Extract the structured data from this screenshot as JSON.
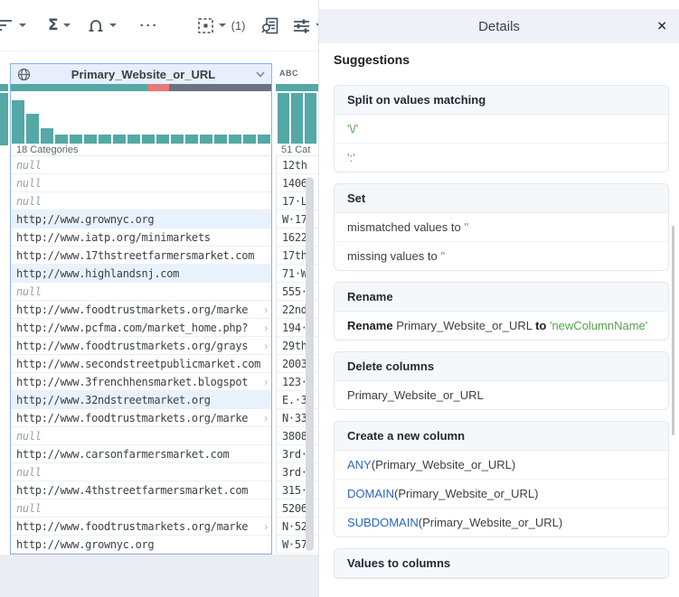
{
  "toolbar": {
    "sigma": "Σ",
    "ellipsis": "···",
    "selection_count": "(1)"
  },
  "grid": {
    "selected_column": {
      "name": "Primary_Website_or_URL",
      "categories_label": "18 Categories",
      "quality": {
        "valid_pct": 52.4,
        "mismatched_pct": 8.3,
        "missing_pct": 39.3
      },
      "histogram": [
        48,
        33,
        17,
        10,
        10,
        10,
        10,
        10,
        10,
        10,
        10,
        10,
        10,
        10,
        10,
        10,
        10,
        10
      ],
      "rows": [
        {
          "text": "null",
          "is_null": true
        },
        {
          "text": "null",
          "is_null": true
        },
        {
          "text": "null",
          "is_null": true
        },
        {
          "text": "http;//www.grownyc.org",
          "hl": true
        },
        {
          "text": "http://www.iatp.org/minimarkets"
        },
        {
          "text": "http://www.17thstreetfarmersmarket.com"
        },
        {
          "text": "http;//www.highlandsnj.com",
          "hl": true
        },
        {
          "text": "null",
          "is_null": true
        },
        {
          "text": "http://www.foodtrustmarkets.org/marke",
          "trunc": true
        },
        {
          "text": "http://www.pcfma.com/market_home.php?",
          "trunc": true
        },
        {
          "text": "http://www.foodtrustmarkets.org/grays",
          "trunc": true
        },
        {
          "text": "http://www.secondstreetpublicmarket.com"
        },
        {
          "text": "http://www.3frenchhensmarket.blogspot",
          "trunc": true
        },
        {
          "text": "http;//www.32ndstreetmarket.org",
          "hl": true
        },
        {
          "text": "http://www.foodtrustmarkets.org/marke",
          "trunc": true
        },
        {
          "text": "null",
          "is_null": true
        },
        {
          "text": "http://www.carsonfarmersmarket.com"
        },
        {
          "text": "null",
          "is_null": true
        },
        {
          "text": "http://www.4thstreetfarmersmarket.com"
        },
        {
          "text": "null",
          "is_null": true
        },
        {
          "text": "http://www.foodtrustmarkets.org/marke",
          "trunc": true
        },
        {
          "text": "http://www.grownyc.org"
        }
      ]
    },
    "next_column": {
      "type_label": "ABC",
      "categories_label": "51 Cat",
      "histogram": [
        56,
        56,
        56
      ],
      "rows": [
        "12th",
        "1406",
        "17·L",
        "W·17",
        "1622",
        "17th",
        "71·W",
        "555·",
        "22nd",
        "194·",
        "29th",
        "2003",
        "123·",
        "E.·3",
        "N·33",
        "3808",
        "3rd·",
        "3rd·",
        "315·",
        "5206",
        "N·52",
        "W·57"
      ]
    }
  },
  "details": {
    "title": "Details",
    "close_glyph": "✕",
    "suggestions_label": "Suggestions",
    "split": {
      "title": "Split on values matching",
      "patterns": [
        "'\\/'",
        "':'"
      ]
    },
    "set": {
      "title": "Set",
      "rows": [
        {
          "text": "mismatched values to ",
          "value": "''"
        },
        {
          "text": "missing values to ",
          "value": "''"
        }
      ]
    },
    "rename": {
      "title": "Rename",
      "verb": "Rename",
      "column": " Primary_Website_or_URL ",
      "to": "to",
      "value": " 'newColumnName'"
    },
    "delete": {
      "title": "Delete columns",
      "column": "Primary_Website_or_URL"
    },
    "create": {
      "title": "Create a new column",
      "rows": [
        {
          "fn": "ANY",
          "args": "(Primary_Website_or_URL)"
        },
        {
          "fn": "DOMAIN",
          "args": "(Primary_Website_or_URL)"
        },
        {
          "fn": "SUBDOMAIN",
          "args": "(Primary_Website_or_URL)"
        }
      ]
    },
    "values_to_columns": {
      "title": "Values to columns"
    }
  },
  "colors": {
    "valid_teal": "#54a8a5",
    "mismatched_red": "#e57a76",
    "missing_gray": "#6b7380",
    "selection_blue": "#8ab0f5",
    "suggestion_green": "#56a14e",
    "function_blue": "#2a66c4"
  }
}
